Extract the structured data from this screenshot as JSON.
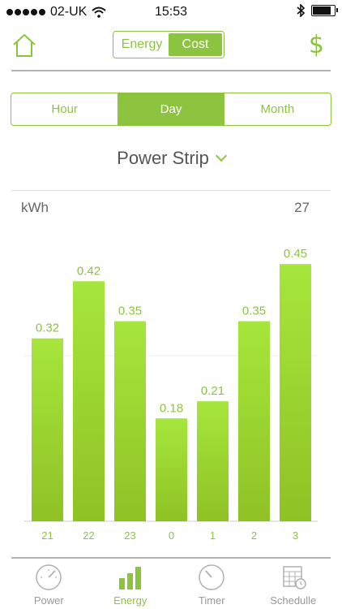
{
  "status_bar": {
    "carrier": "02-UK",
    "time": "15:53"
  },
  "header": {
    "segments": [
      "Energy",
      "Cost"
    ],
    "active_segment": "Cost",
    "currency_symbol": "$"
  },
  "period_tabs": [
    "Hour",
    "Day",
    "Month"
  ],
  "active_period": "Day",
  "device": {
    "name": "Power Strip"
  },
  "chart_header": {
    "unit": "kWh",
    "total": "27"
  },
  "colors": {
    "accent": "#8cc43f",
    "bar_top": "#a6e63c",
    "bar_bottom": "#8fc225"
  },
  "chart_data": {
    "type": "bar",
    "categories": [
      "21",
      "22",
      "23",
      "0",
      "1",
      "2",
      "3"
    ],
    "values": [
      0.32,
      0.42,
      0.35,
      0.18,
      0.21,
      0.35,
      0.45
    ],
    "value_labels": [
      "0.32",
      "0.42",
      "0.35",
      "0.18",
      "0.21",
      "0.35",
      "0.45"
    ],
    "ylabel": "kWh",
    "ylim": [
      0,
      0.5
    ],
    "grid": false
  },
  "tabbar": {
    "items": [
      {
        "label": "Power",
        "icon": "gauge-icon"
      },
      {
        "label": "Energy",
        "icon": "bar-chart-icon"
      },
      {
        "label": "Timer",
        "icon": "clock-icon"
      },
      {
        "label": "Schedulle",
        "icon": "calendar-icon"
      }
    ],
    "active": "Energy"
  }
}
